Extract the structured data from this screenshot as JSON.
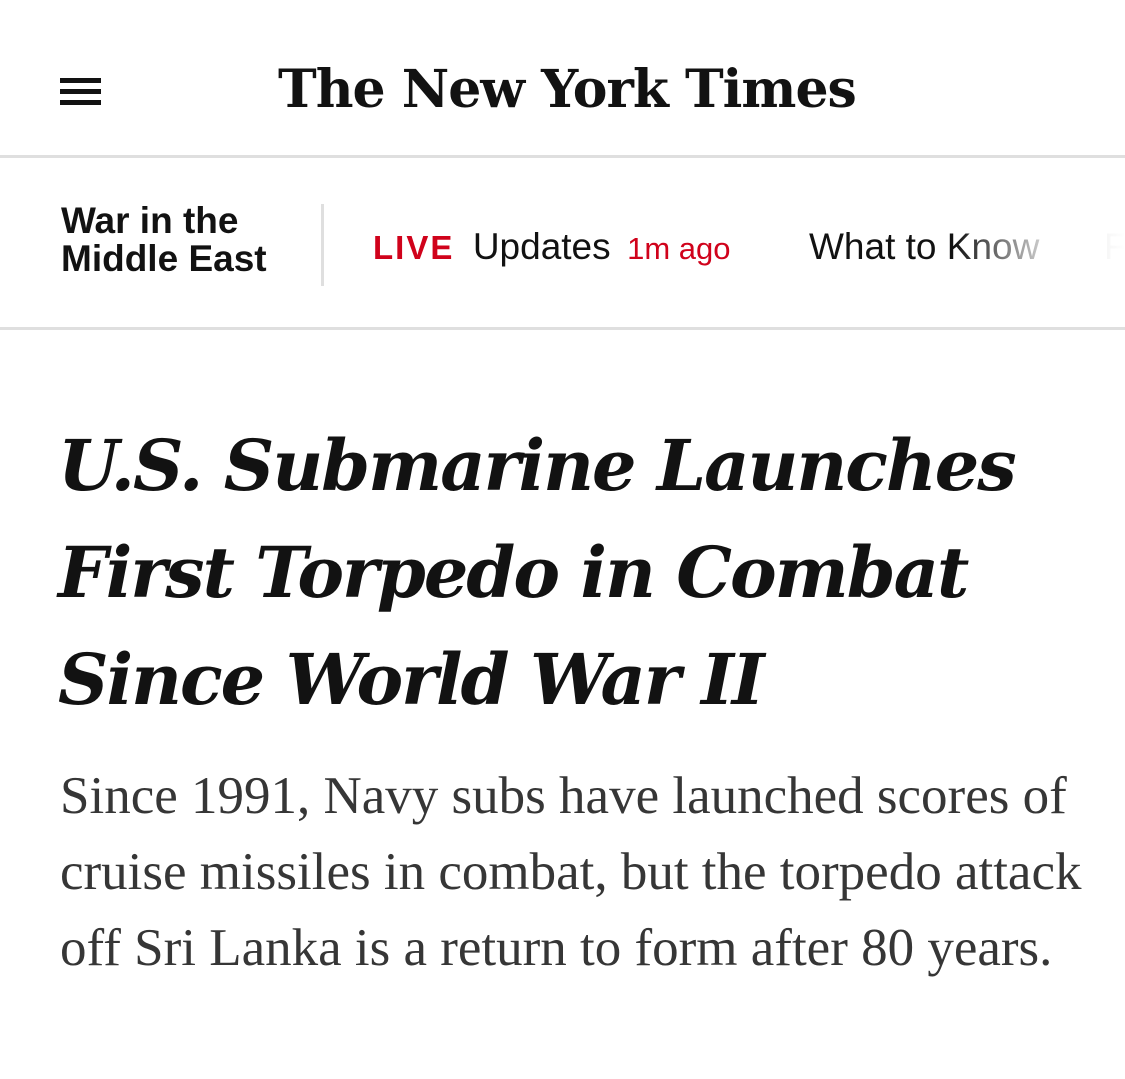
{
  "header": {
    "menu_icon": "hamburger-menu-icon",
    "logo_text": "The New York Times"
  },
  "section_nav": {
    "title": "War in the Middle East",
    "live": {
      "badge": "LIVE",
      "label": "Updates",
      "time": "1m ago"
    },
    "items": [
      {
        "label": "What to Know"
      },
      {
        "label": "F"
      }
    ]
  },
  "article": {
    "headline": "U.S. Submarine Launches First Torpedo in Combat Since World War II",
    "summary": "Since 1991, Navy subs have launched scores of cruise missiles in combat, but the torpedo attack off Sri Lanka is a return to form after 80 years."
  },
  "colors": {
    "accent_red": "#d0021b",
    "text": "#121212",
    "summary_text": "#363636",
    "divider": "#dfdfdf"
  }
}
